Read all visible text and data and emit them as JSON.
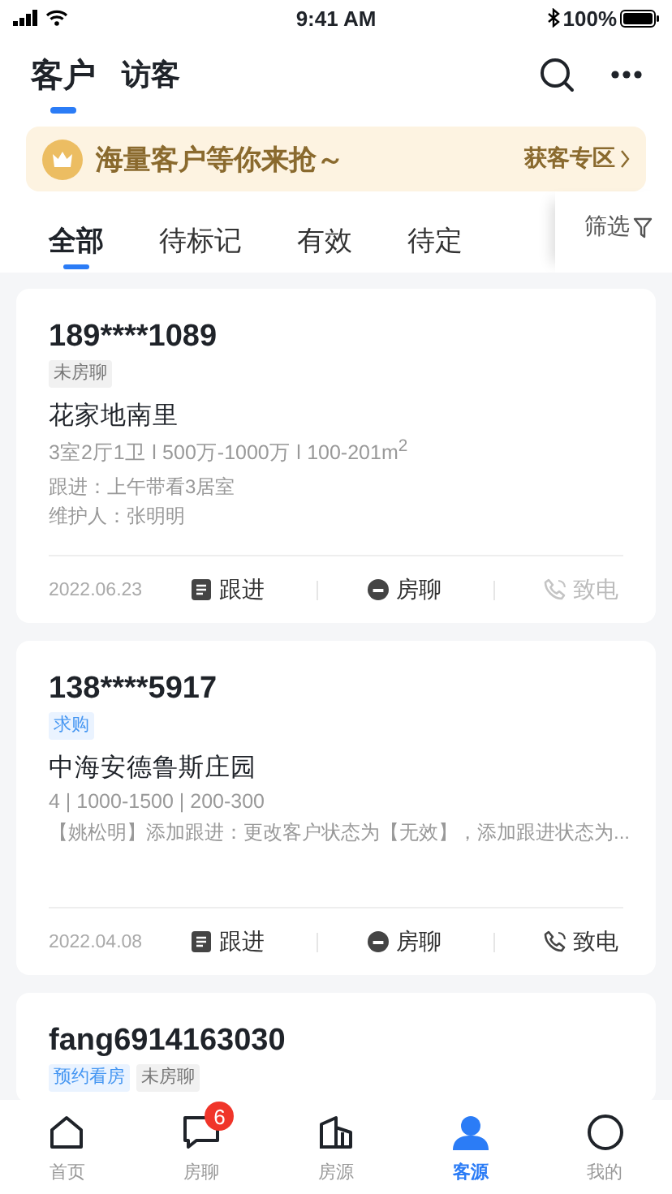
{
  "status_bar": {
    "time": "9:41 AM",
    "battery": "100%"
  },
  "header": {
    "tabs": [
      {
        "label": "客户",
        "selected": true
      },
      {
        "label": "访客",
        "selected": false
      }
    ]
  },
  "banner": {
    "text": "海量客户等你来抢～",
    "link": "获客专区"
  },
  "filters": {
    "tabs": [
      {
        "label": "全部",
        "selected": true
      },
      {
        "label": "待标记",
        "selected": false
      },
      {
        "label": "有效",
        "selected": false
      },
      {
        "label": "待定",
        "selected": false
      }
    ],
    "filter_button": "筛选"
  },
  "customers": [
    {
      "phone": "189****1089",
      "tags": [
        {
          "text": "未房聊",
          "kind": "gray"
        }
      ],
      "name": "花家地南里",
      "specs": "3室2厅1卫 ǀ 500万-1000万 ǀ 100-201m$^{2}$",
      "lines": [
        "跟进：上午带看3居室",
        "维护人：张明明"
      ],
      "date": "2022.06.23",
      "actions": [
        {
          "label": "跟进",
          "kind": "follow",
          "disabled": false
        },
        {
          "label": "房聊",
          "kind": "chat",
          "disabled": false
        },
        {
          "label": "致电",
          "kind": "call",
          "disabled": true
        }
      ]
    },
    {
      "phone": "138****5917",
      "tags": [
        {
          "text": "求购",
          "kind": "blue"
        }
      ],
      "name": "中海安德鲁斯庄园",
      "specs": "4 | 1000-1500 | 200-300",
      "lines": [
        "【姚松明】添加跟进：更改客户状态为【无效】，添加跟进状态为..."
      ],
      "date": "2022.04.08",
      "actions": [
        {
          "label": "跟进",
          "kind": "follow",
          "disabled": false
        },
        {
          "label": "房聊",
          "kind": "chat",
          "disabled": false
        },
        {
          "label": "致电",
          "kind": "call",
          "disabled": false
        }
      ]
    },
    {
      "phone": "fang6914163030",
      "tags": [
        {
          "text": "预约看房",
          "kind": "blue"
        },
        {
          "text": "未房聊",
          "kind": "gray"
        }
      ]
    }
  ],
  "bottom_nav": [
    {
      "label": "首页",
      "kind": "home",
      "selected": false
    },
    {
      "label": "房聊",
      "kind": "chat",
      "selected": false,
      "badge": "6"
    },
    {
      "label": "房源",
      "kind": "building",
      "selected": false
    },
    {
      "label": "客源",
      "kind": "person",
      "selected": true
    },
    {
      "label": "我的",
      "kind": "circle",
      "selected": false
    }
  ]
}
